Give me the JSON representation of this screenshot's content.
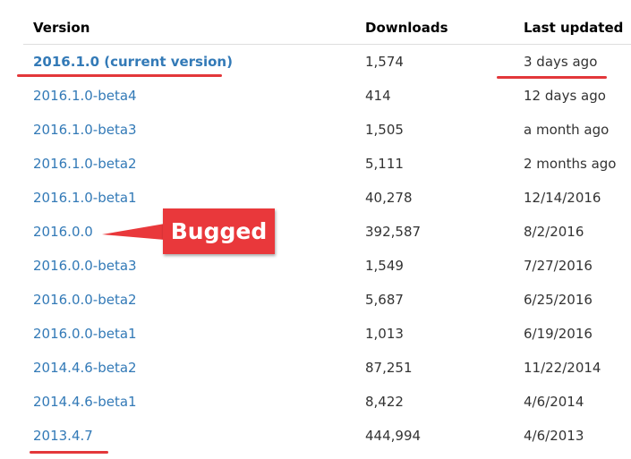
{
  "table": {
    "headers": {
      "version": "Version",
      "downloads": "Downloads",
      "last_updated": "Last updated"
    },
    "rows": [
      {
        "version": "2016.1.0 (current version)",
        "downloads": "1,574",
        "last_updated": "3 days ago"
      },
      {
        "version": "2016.1.0-beta4",
        "downloads": "414",
        "last_updated": "12 days ago"
      },
      {
        "version": "2016.1.0-beta3",
        "downloads": "1,505",
        "last_updated": "a month ago"
      },
      {
        "version": "2016.1.0-beta2",
        "downloads": "5,111",
        "last_updated": "2 months ago"
      },
      {
        "version": "2016.1.0-beta1",
        "downloads": "40,278",
        "last_updated": "12/14/2016"
      },
      {
        "version": "2016.0.0",
        "downloads": "392,587",
        "last_updated": "8/2/2016"
      },
      {
        "version": "2016.0.0-beta3",
        "downloads": "1,549",
        "last_updated": "7/27/2016"
      },
      {
        "version": "2016.0.0-beta2",
        "downloads": "5,687",
        "last_updated": "6/25/2016"
      },
      {
        "version": "2016.0.0-beta1",
        "downloads": "1,013",
        "last_updated": "6/19/2016"
      },
      {
        "version": "2014.4.6-beta2",
        "downloads": "87,251",
        "last_updated": "11/22/2014"
      },
      {
        "version": "2014.4.6-beta1",
        "downloads": "8,422",
        "last_updated": "4/6/2014"
      },
      {
        "version": "2013.4.7",
        "downloads": "444,994",
        "last_updated": "4/6/2013"
      }
    ]
  },
  "annotation": {
    "label": "Bugged"
  },
  "colors": {
    "link": "#337ab7",
    "annotation_red": "#e9383b",
    "header_text": "#000000",
    "cell_text": "#333333"
  }
}
